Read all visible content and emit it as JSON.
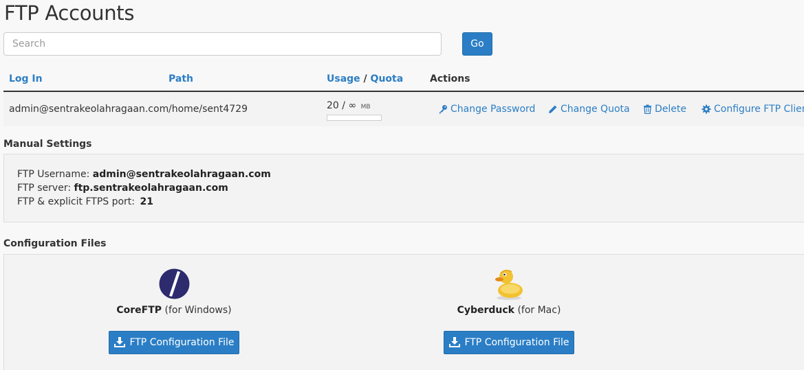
{
  "page": {
    "title": "FTP Accounts"
  },
  "search": {
    "placeholder": "Search",
    "go_label": "Go"
  },
  "table": {
    "headers": {
      "login": "Log In",
      "path": "Path",
      "usage": "Usage",
      "separator": "/",
      "quota": "Quota",
      "actions": "Actions"
    },
    "rows": [
      {
        "login": "admin@sentrakeolahragaan.com",
        "path": "/home/sent4729",
        "usage_value": "20",
        "usage_sep": "/",
        "quota_value": "∞",
        "unit": "MB",
        "usage_fraction": 0
      }
    ],
    "actions": {
      "change_password": "Change Password",
      "change_quota": "Change Quota",
      "delete": "Delete",
      "configure": "Configure FTP Client"
    }
  },
  "manual_settings": {
    "title": "Manual Settings",
    "username_label": "FTP Username:",
    "username_value": "admin@sentrakeolahragaan.com",
    "server_label": "FTP server:",
    "server_value": "ftp.sentrakeolahragaan.com",
    "port_label": "FTP & explicit FTPS port:",
    "port_value": "21"
  },
  "config_files": {
    "title": "Configuration Files",
    "clients": [
      {
        "name": "CoreFTP",
        "platform": "(for Windows)",
        "button": "FTP Configuration File",
        "icon": "coreftp-logo-icon"
      },
      {
        "name": "Cyberduck",
        "platform": "(for Mac)",
        "button": "FTP Configuration File",
        "icon": "cyberduck-logo-icon"
      }
    ]
  },
  "colors": {
    "accent": "#2b7ec5",
    "text": "#333333",
    "panel": "#f3f3f3",
    "coreftp": "#2d2a6e",
    "duck": "#f2c232"
  }
}
